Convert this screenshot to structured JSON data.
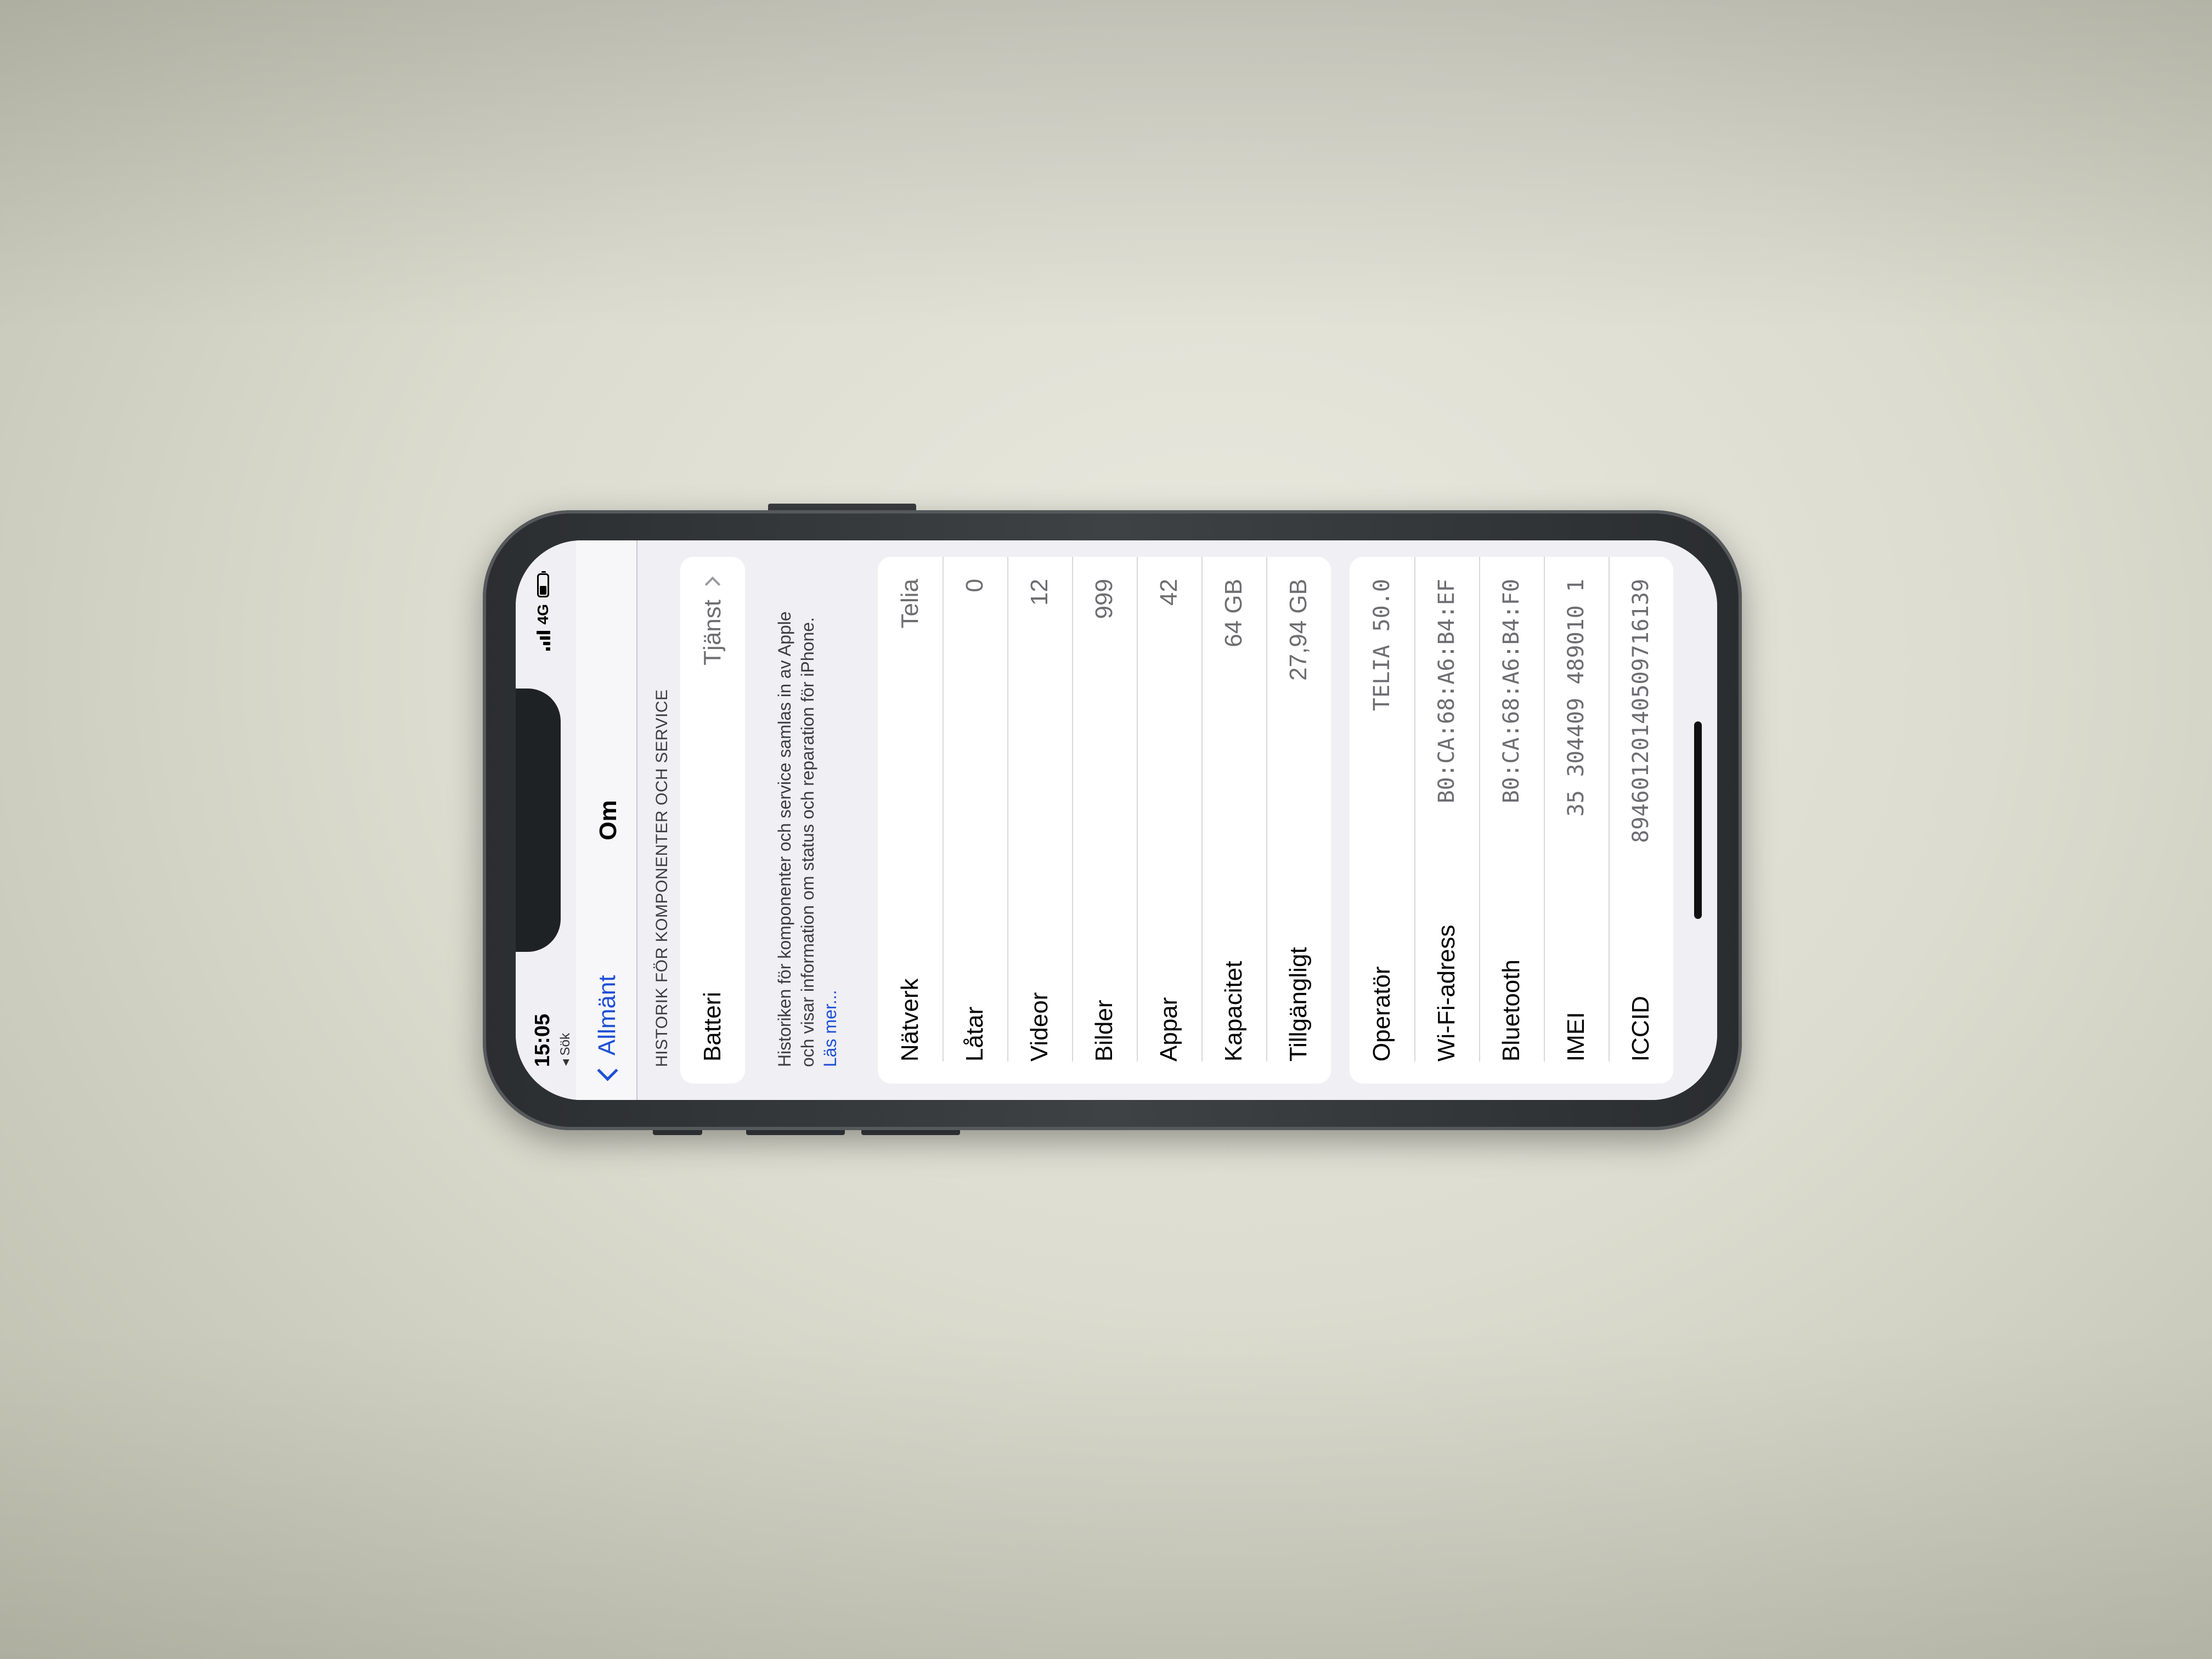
{
  "status_bar": {
    "time": "15:05",
    "back_app": "◂ Sök",
    "network": "4G"
  },
  "navbar": {
    "back_label": "Allmänt",
    "title": "Om"
  },
  "component_history": {
    "header": "HISTORIK FÖR KOMPONENTER OCH SERVICE",
    "row_label": "Batteri",
    "row_value": "Tjänst",
    "footnote": "Historiken för komponenter och service samlas in av Apple och visar information om status och reparation för iPhone.",
    "footnote_link": "Läs mer..."
  },
  "info_rows": [
    {
      "label": "Nätverk",
      "value": "Telia"
    },
    {
      "label": "Låtar",
      "value": "0"
    },
    {
      "label": "Videor",
      "value": "12"
    },
    {
      "label": "Bilder",
      "value": "999"
    },
    {
      "label": "Appar",
      "value": "42"
    },
    {
      "label": "Kapacitet",
      "value": "64 GB"
    },
    {
      "label": "Tillgängligt",
      "value": "27,94 GB"
    }
  ],
  "device_rows": [
    {
      "label": "Operatör",
      "value": "TELIA 50.0"
    },
    {
      "label": "Wi-Fi-adress",
      "value": "B0:CA:68:A6:B4:EF"
    },
    {
      "label": "Bluetooth",
      "value": "B0:CA:68:A6:B4:F0"
    },
    {
      "label": "IMEI",
      "value": "35 304409 489010 1"
    },
    {
      "label": "ICCID",
      "value": "8946012014050971613​9"
    }
  ],
  "colors": {
    "accent": "#1f4fd6",
    "background": "#efeff4",
    "table": "#dcdcd0"
  }
}
